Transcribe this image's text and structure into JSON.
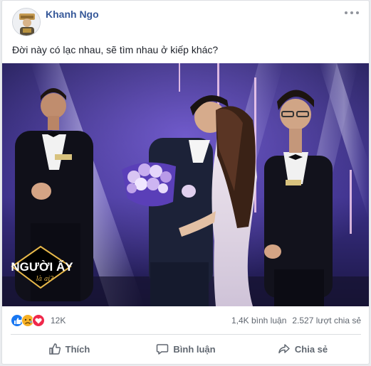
{
  "post": {
    "author": "Khanh Ngo",
    "text": "Đời này có lạc nhau, sẽ tìm nhau ở kiếp khác?",
    "photo": {
      "logo_line1": "NGƯỜI ẤY",
      "logo_line2": "là ai?"
    }
  },
  "reactions": {
    "icons": [
      "like-icon",
      "sad-icon",
      "love-icon"
    ],
    "count": "12K",
    "comments": "1,4K bình luận",
    "shares": "2.527 lượt chia sẻ"
  },
  "actions": {
    "like": "Thích",
    "comment": "Bình luận",
    "share": "Chia sẻ"
  },
  "colors": {
    "brand": "#365899",
    "like": "#1877f2",
    "love": "#f0284a",
    "sad": "#f7b125"
  }
}
